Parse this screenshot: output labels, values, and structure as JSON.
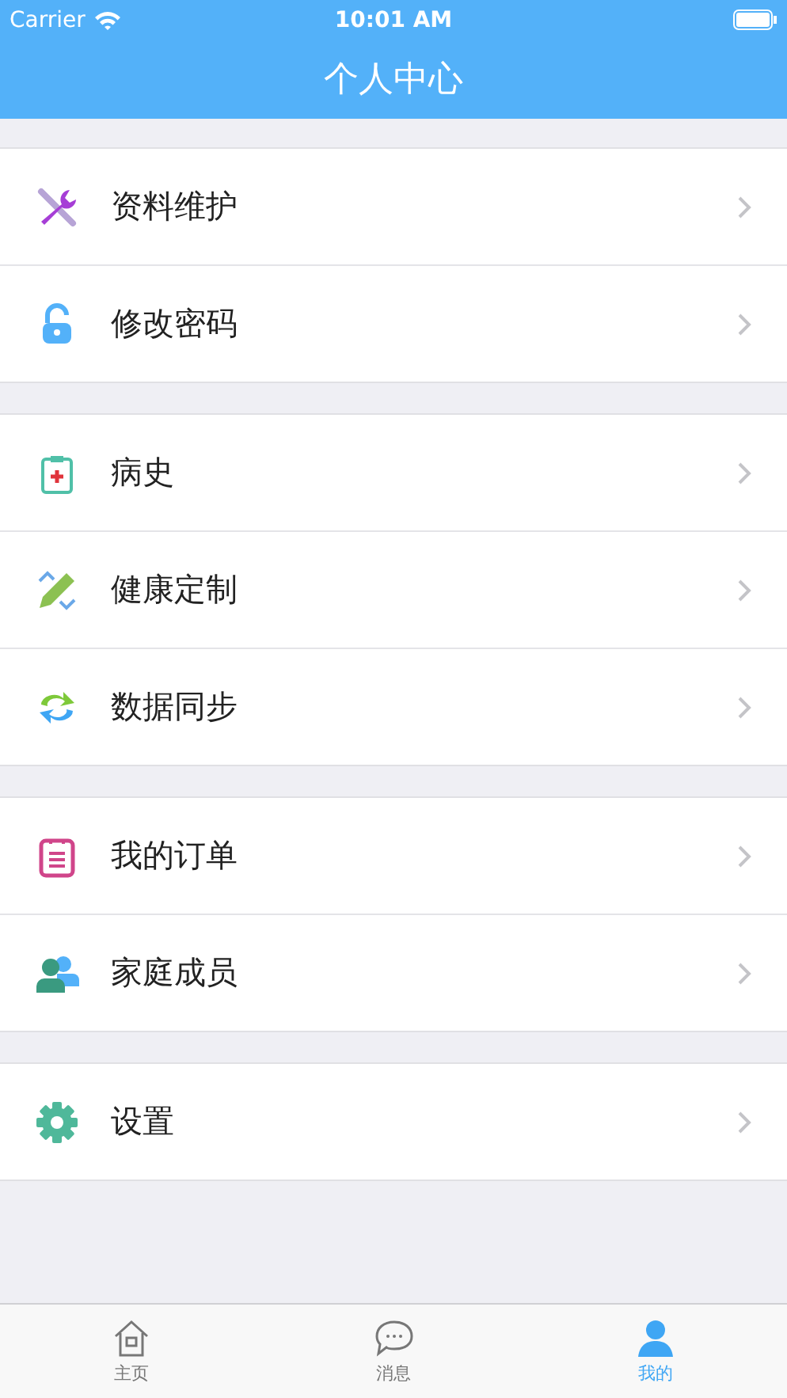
{
  "status_bar": {
    "carrier": "Carrier",
    "time": "10:01 AM"
  },
  "nav_bar": {
    "title": "个人中心"
  },
  "groups": [
    {
      "items": [
        {
          "kind": "wrench",
          "label": "资料维护"
        },
        {
          "kind": "lock",
          "label": "修改密码"
        }
      ]
    },
    {
      "items": [
        {
          "kind": "clipboard",
          "label": "病史"
        },
        {
          "kind": "pencil",
          "label": "健康定制"
        },
        {
          "kind": "sync",
          "label": "数据同步"
        }
      ]
    },
    {
      "items": [
        {
          "kind": "order",
          "label": "我的订单"
        },
        {
          "kind": "family",
          "label": "家庭成员"
        }
      ]
    },
    {
      "items": [
        {
          "kind": "gear",
          "label": "设置"
        }
      ]
    }
  ],
  "tab_bar": [
    {
      "kind": "home",
      "label": "主页",
      "selected": false
    },
    {
      "kind": "chat",
      "label": "消息",
      "selected": false
    },
    {
      "kind": "person",
      "label": "我的",
      "selected": true
    }
  ]
}
